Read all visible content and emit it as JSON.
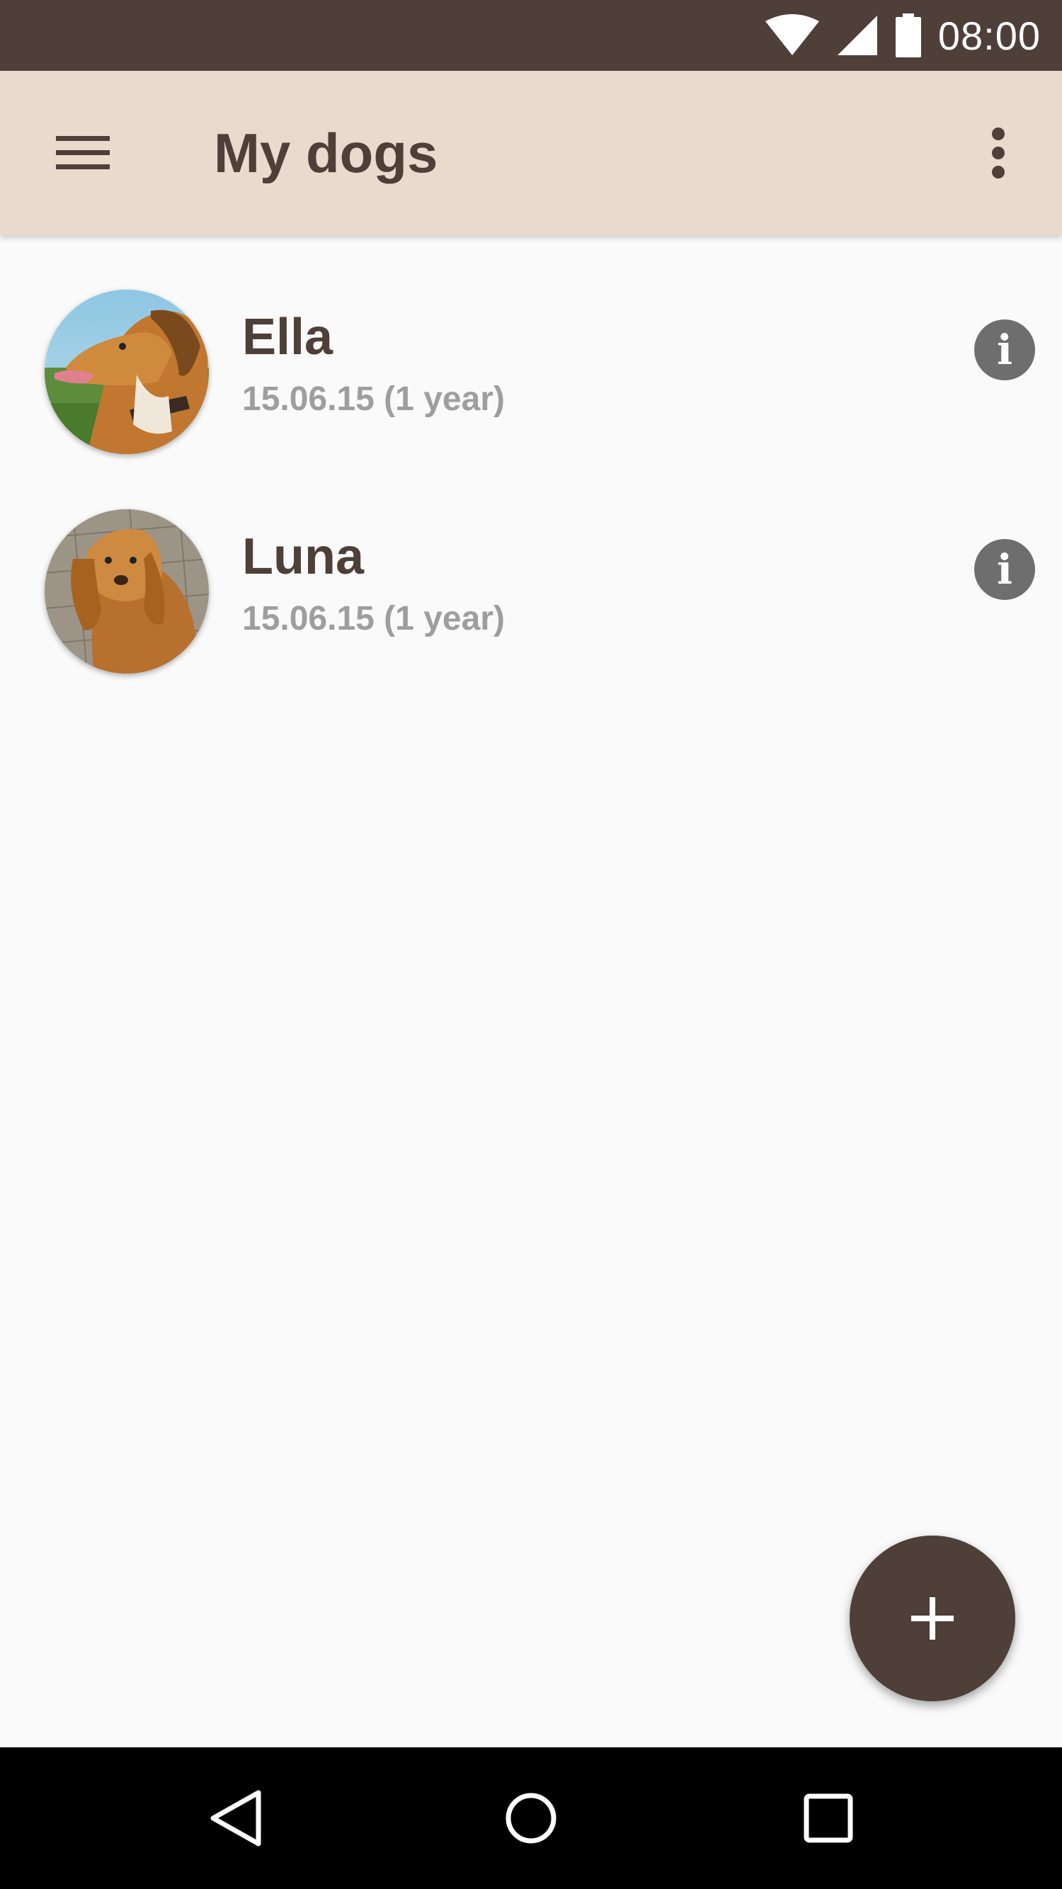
{
  "status_bar": {
    "time": "08:00",
    "icons": [
      "wifi-icon",
      "cell-signal-icon",
      "battery-icon"
    ],
    "background": "#4e3f38"
  },
  "app_bar": {
    "title": "My dogs",
    "menu_icon": "hamburger-menu-icon",
    "overflow_icon": "more-vert-icon",
    "background": "#e8dbcd"
  },
  "dogs": [
    {
      "name": "Ella",
      "date": "15.06.15 (1 year)",
      "avatar_icon": "dog-photo-ella",
      "info_icon": "info-icon",
      "info_symbol": "i"
    },
    {
      "name": "Luna",
      "date": "15.06.15 (1 year)",
      "avatar_icon": "dog-photo-luna",
      "info_icon": "info-icon",
      "info_symbol": "i"
    }
  ],
  "fab": {
    "icon": "plus-icon",
    "background": "#4e3f38"
  },
  "nav_bar": {
    "buttons": [
      "back-icon",
      "home-icon",
      "recents-icon"
    ]
  },
  "colors": {
    "primary_dark": "#4e3f38",
    "text_secondary": "#9e9e9e",
    "info_grey": "#6e6e6e",
    "page_bg": "#fafafa"
  }
}
